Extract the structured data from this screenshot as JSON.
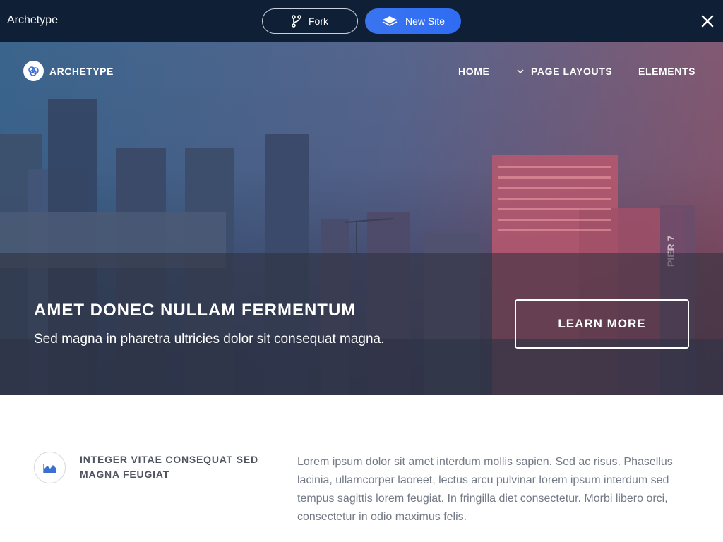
{
  "app": {
    "title": "Archetype",
    "fork_label": "Fork",
    "new_site_label": "New Site"
  },
  "site": {
    "logo_text": "ARCHETYPE",
    "nav": {
      "home": "HOME",
      "page_layouts": "PAGE LAYOUTS",
      "elements": "ELEMENTS"
    }
  },
  "hero": {
    "title": "AMET DONEC NULLAM FERMENTUM",
    "subtitle": "Sed magna in pharetra ultricies dolor sit consequat magna.",
    "button_label": "LEARN MORE",
    "sign_text": "PIER 7"
  },
  "feature": {
    "icon": "area-chart-icon",
    "title": "INTEGER VITAE CONSEQUAT SED MAGNA FEUGIAT",
    "body": "Lorem ipsum dolor sit amet interdum mollis sapien. Sed ac risus. Phasellus lacinia, ullamcorper laoreet, lectus arcu pulvinar lorem ipsum interdum sed tempus sagittis lorem feugiat. In fringilla diet consectetur. Morbi libero orci, consectetur in odio maximus felis."
  },
  "colors": {
    "topbar": "#0f1f36",
    "new_site": "#2f6cf3",
    "accent_icon": "#3b6fd1"
  }
}
